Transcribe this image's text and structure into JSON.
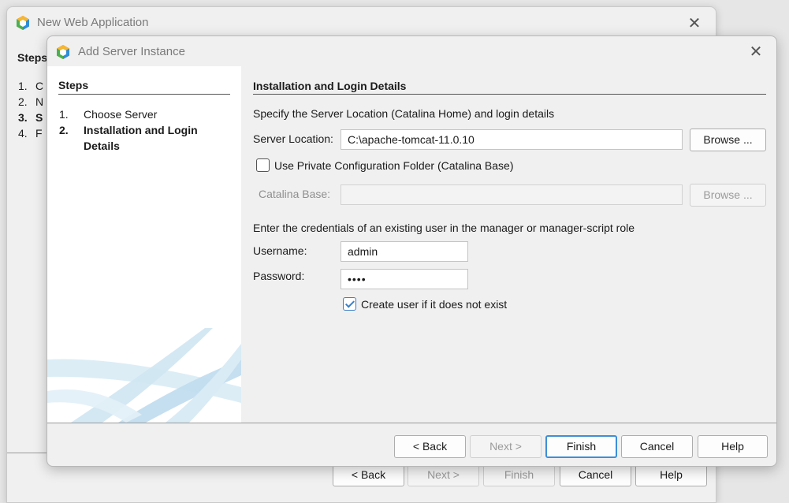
{
  "back_window": {
    "title": "New Web Application",
    "close_glyph": "✕",
    "steps_title": "Steps",
    "steps": [
      {
        "num": "1.",
        "label": "C"
      },
      {
        "num": "2.",
        "label": "N"
      },
      {
        "num": "3.",
        "label": "S"
      },
      {
        "num": "4.",
        "label": "F"
      }
    ],
    "buttons": {
      "back": "< Back",
      "next": "Next >",
      "finish": "Finish",
      "cancel": "Cancel",
      "help": "Help"
    }
  },
  "dialog": {
    "title": "Add Server Instance",
    "close_glyph": "✕",
    "steps_title": "Steps",
    "steps": [
      {
        "num": "1.",
        "label": "Choose Server"
      },
      {
        "num": "2.",
        "label": "Installation and Login Details"
      }
    ],
    "section_title": "Installation and Login Details",
    "instruction": "Specify the Server Location (Catalina Home) and login details",
    "server_location_label": "Server Location:",
    "server_location_value": "C:\\apache-tomcat-11.0.10",
    "browse_label": "Browse ...",
    "private_config_label": "Use Private Configuration Folder (Catalina Base)",
    "private_config_checked": false,
    "catalina_base_label": "Catalina Base:",
    "catalina_base_value": "",
    "browse_disabled_label": "Browse ...",
    "credentials_text": "Enter the credentials of an existing user in the manager or manager-script role",
    "username_label": "Username:",
    "username_value": "admin",
    "password_label": "Password:",
    "password_value": "••••",
    "create_user_label": "Create user if it does not exist",
    "create_user_checked": true,
    "buttons": {
      "back": "< Back",
      "next": "Next >",
      "finish": "Finish",
      "cancel": "Cancel",
      "help": "Help"
    }
  },
  "colors": {
    "accent": "#3d8ed8",
    "swoosh": "#c8e2f2"
  },
  "icons": {
    "app_icon": "netbeans-cube-icon",
    "close": "close-icon",
    "checkbox_check": "check-icon"
  }
}
